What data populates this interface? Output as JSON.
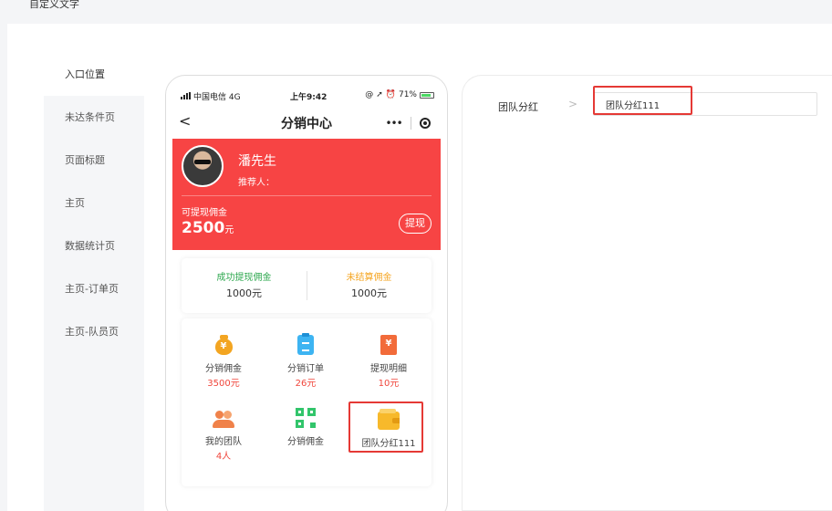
{
  "page": {
    "title": "自定义文字"
  },
  "side_menu": {
    "items": [
      {
        "label": "入口位置",
        "active": true
      },
      {
        "label": "未达条件页",
        "active": false
      },
      {
        "label": "页面标题",
        "active": false
      },
      {
        "label": "主页",
        "active": false
      },
      {
        "label": "数据统计页",
        "active": false
      },
      {
        "label": "主页-订单页",
        "active": false
      },
      {
        "label": "主页-队员页",
        "active": false
      }
    ]
  },
  "phone": {
    "status_bar": {
      "carrier": "中国电信",
      "network": "4G",
      "time": "上午9:42",
      "battery": "71%"
    },
    "nav": {
      "title": "分销中心"
    },
    "banner": {
      "user_name": "潘先生",
      "referrer_label": "推荐人：",
      "withdrawable_label": "可提现佣金",
      "amount": "2500",
      "amount_unit": "元",
      "withdraw_label": "提现",
      "color": "#f74444"
    },
    "stats": [
      {
        "label": "成功提现佣金",
        "value": "1000元",
        "color": "#2ea84f"
      },
      {
        "label": "未结算佣金",
        "value": "1000元",
        "color": "#f5a623"
      }
    ],
    "grid": [
      {
        "label": "分销佣金",
        "sub": "3500元",
        "icon": "money-bag-icon"
      },
      {
        "label": "分销订单",
        "sub": "26元",
        "icon": "clipboard-icon"
      },
      {
        "label": "提现明细",
        "sub": "10元",
        "icon": "receipt-icon"
      },
      {
        "label": "我的团队",
        "sub": "4人",
        "icon": "team-icon"
      },
      {
        "label": "分销佣金",
        "sub": "",
        "icon": "qr-icon"
      },
      {
        "label": "团队分红111",
        "sub": "",
        "icon": "wallet-icon"
      }
    ],
    "sub_color": "#f0463c"
  },
  "config": {
    "field_label": "团队分红",
    "field_value": "团队分红111",
    "highlight_color": "#e53935"
  }
}
